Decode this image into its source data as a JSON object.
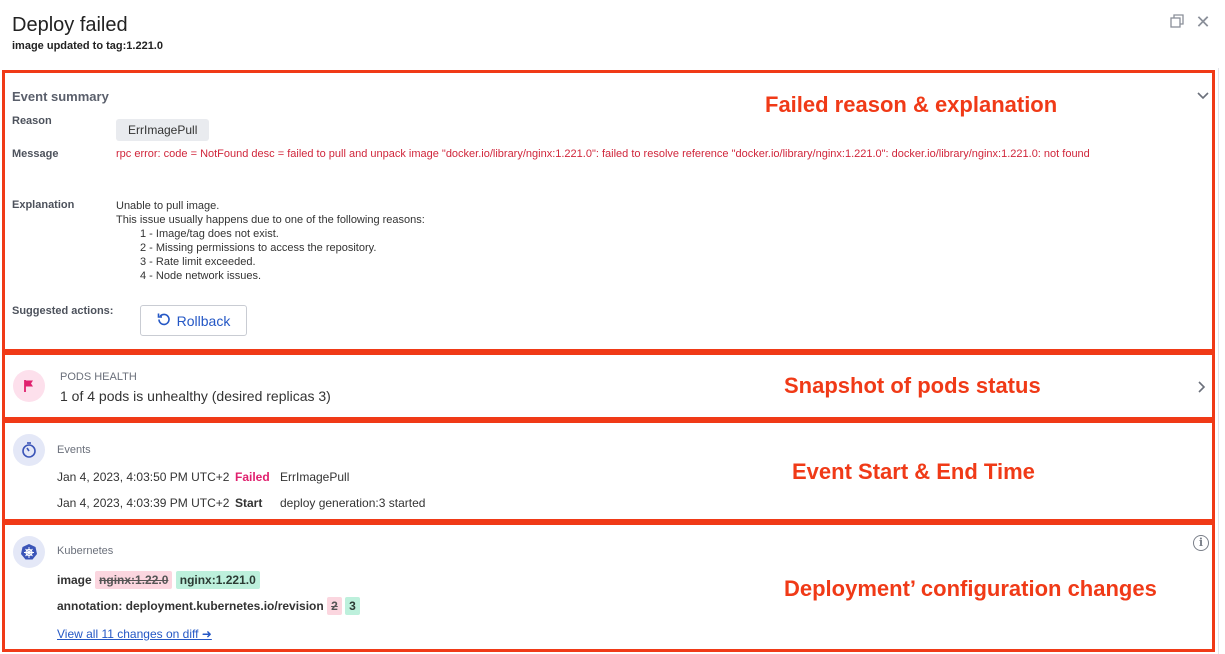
{
  "header": {
    "title": "Deploy failed",
    "subtitle": "image updated to tag:1.221.0"
  },
  "annotations": {
    "failed_reason": "Failed reason & explanation",
    "pods_status": "Snapshot of pods status",
    "event_time": "Event Start & End Time",
    "config_changes": "Deployment’ configuration changes"
  },
  "event_summary": {
    "title": "Event summary",
    "reason_label": "Reason",
    "reason_value": "ErrImagePull",
    "message_label": "Message",
    "message_value": "rpc error: code = NotFound desc = failed to pull and unpack image \"docker.io/library/nginx:1.221.0\": failed to resolve reference \"docker.io/library/nginx:1.221.0\": docker.io/library/nginx:1.221.0: not found",
    "explanation_label": "Explanation",
    "explanation_lines": [
      "Unable to pull image.",
      "This issue usually happens due to one of the following reasons:",
      "1 - Image/tag does not exist.",
      "2 - Missing permissions to access the repository.",
      "3 - Rate limit exceeded.",
      "4 - Node network issues."
    ],
    "suggested_label": "Suggested actions:",
    "rollback_label": "Rollback"
  },
  "pods_health": {
    "caption": "PODS HEALTH",
    "text": "1 of 4 pods is unhealthy (desired replicas 3)"
  },
  "events": {
    "title": "Events",
    "rows": [
      {
        "time": "Jan 4, 2023, 4:03:50 PM UTC+2",
        "status": "Failed",
        "detail": "ErrImagePull"
      },
      {
        "time": "Jan 4, 2023, 4:03:39 PM UTC+2",
        "status": "Start",
        "detail": "deploy generation:3 started"
      }
    ]
  },
  "kubernetes": {
    "title": "Kubernetes",
    "image_label": "image",
    "image_old": "nginx:1.22.0",
    "image_new": "nginx:1.221.0",
    "annotation_label": "annotation: deployment.kubernetes.io/revision",
    "annotation_old": "2",
    "annotation_new": "3",
    "diff_link": "View all 11 changes on diff ➜"
  },
  "colors": {
    "annotation_red": "#f03a17",
    "error_red": "#d0263b",
    "failed_pink": "#e0206e",
    "link_blue": "#2457c5"
  }
}
